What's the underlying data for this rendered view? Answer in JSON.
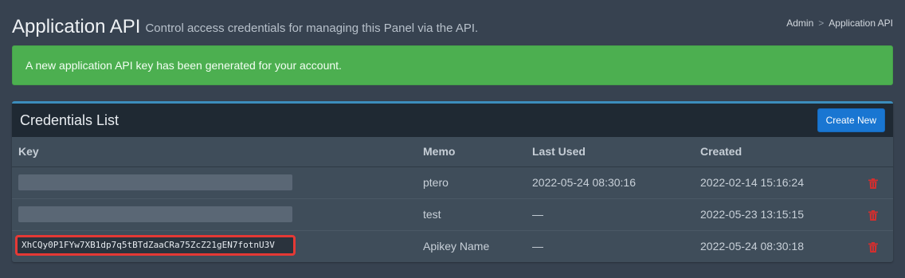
{
  "header": {
    "title": "Application API",
    "subtitle": "Control access credentials for managing this Panel via the API."
  },
  "breadcrumb": {
    "items": [
      "Admin",
      "Application API"
    ],
    "separator": ">"
  },
  "alert": {
    "message": "A new application API key has been generated for your account.",
    "color": "#4caf50"
  },
  "credentials": {
    "title": "Credentials List",
    "create_label": "Create New",
    "columns": [
      "Key",
      "Memo",
      "Last Used",
      "Created"
    ],
    "rows": [
      {
        "key": "",
        "memo": "ptero",
        "last_used": "2022-05-24 08:30:16",
        "created": "2022-02-14 15:16:24"
      },
      {
        "key": "",
        "memo": "test",
        "last_used": "—",
        "created": "2022-05-23 13:15:15"
      },
      {
        "key": "XhCQy0P1FYw7XB1dp7q5tBTdZaaCRa75ZcZ21gEN7fotnU3V",
        "memo": "Apikey Name",
        "last_used": "—",
        "created": "2022-05-24 08:30:18"
      }
    ]
  },
  "colors": {
    "accent": "#3c8dbc",
    "button": "#1976d2",
    "delete": "#d32f2f",
    "highlight": "#e53935"
  }
}
